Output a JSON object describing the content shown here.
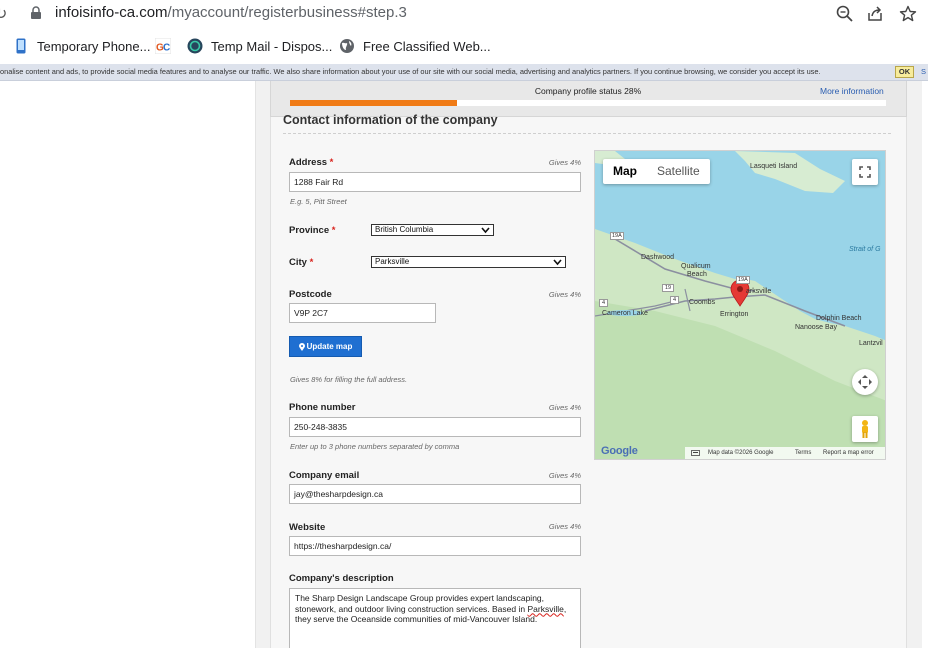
{
  "browser": {
    "url_host": "infoisinfo-ca.com",
    "url_path": "/myaccount/registerbusiness#step.3",
    "bookmarks": [
      {
        "label": "Temporary Phone...",
        "icon": "phone-icon"
      },
      {
        "label": "",
        "icon": "gc-logo-icon"
      },
      {
        "label": "Temp Mail - Dispos...",
        "icon": "temp-mail-icon"
      },
      {
        "label": "Free Classified Web...",
        "icon": "globe-icon"
      }
    ]
  },
  "cookie_banner": {
    "text": "onalise content and ads, to provide social media features and to analyse our traffic. We also share information about your use of our site with our social media, advertising and analytics partners. If you continue browsing, we consider you accept its use.",
    "ok_label": "OK",
    "more_label": "S"
  },
  "status": {
    "label": "Company profile status 28%",
    "progress_fraction": 0.28,
    "more_info": "More information",
    "bar_color": "#f07b16"
  },
  "section_title": "Contact information of the company",
  "fields": {
    "address": {
      "label": "Address",
      "required": "*",
      "gives": "Gives 4%",
      "value": "1288 Fair Rd",
      "hint": "E.g. 5, Pitt Street"
    },
    "province": {
      "label": "Province",
      "required": "*",
      "value": "British Columbia"
    },
    "city": {
      "label": "City",
      "required": "*",
      "value": "Parksville"
    },
    "postcode": {
      "label": "Postcode",
      "gives": "Gives 4%",
      "value": "V9P 2C7"
    },
    "update_map": {
      "label": "Update map"
    },
    "address_hint": "Gives 8% for filling the full address.",
    "phone": {
      "label": "Phone number",
      "gives": "Gives 4%",
      "value": "250-248-3835",
      "hint": "Enter up to 3 phone numbers separated by comma"
    },
    "email": {
      "label": "Company email",
      "gives": "Gives 4%",
      "value": "jay@thesharpdesign.ca"
    },
    "website": {
      "label": "Website",
      "gives": "Gives 4%",
      "value": "https://thesharpdesign.ca/"
    },
    "description": {
      "label": "Company's description",
      "value_before": "The Sharp Design Landscape Group provides expert landscaping, stonework, and outdoor living construction services. Based in ",
      "value_spell": "Parksville",
      "value_after": ", they serve the Oceanside communities of mid-Vancouver Island."
    }
  },
  "map": {
    "tabs": [
      "Map",
      "Satellite"
    ],
    "active_tab": "Map",
    "labels": {
      "lasqueti": "Lasqueti Island",
      "strait": "Strait of G",
      "dashwood": "Dashwood",
      "qualicum": "Qualicum",
      "beach": "Beach",
      "parksville": "arksville",
      "coombs": "Coombs",
      "cameron": "Cameron Lake",
      "errington": "Errington",
      "dolphin": "Dolphin Beach",
      "nanoose": "Nanoose Bay",
      "lantzville": "Lantzvil",
      "hwy19a": "19A",
      "hwy19": "19",
      "hwy4": "4",
      "hwy4a": "4",
      "hwy19a_b": "19A"
    },
    "footer": {
      "logo": "Google",
      "shortcuts": "Keyboard shortcuts",
      "data": "Map data ©2026 Google",
      "terms": "Terms",
      "report": "Report a map error"
    }
  }
}
